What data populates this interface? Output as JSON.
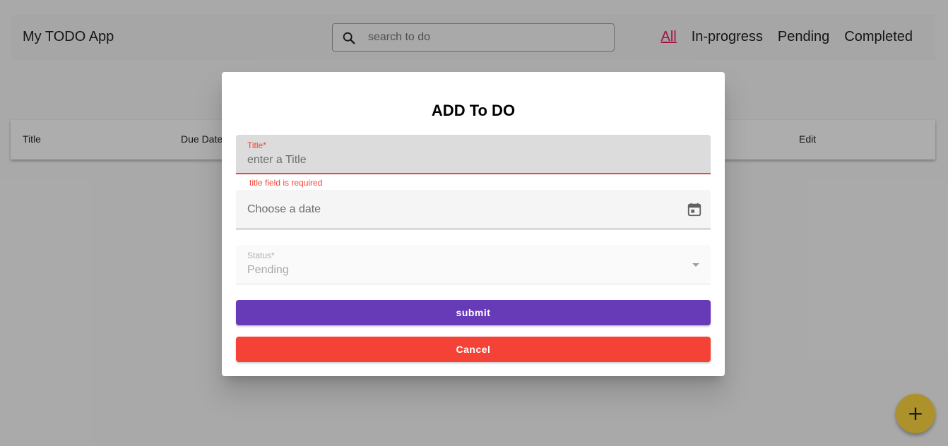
{
  "header": {
    "app_title": "My TODO App",
    "search_placeholder": "search to do",
    "nav": [
      "All",
      "In-progress",
      "Pending",
      "Completed"
    ],
    "active_nav": "All"
  },
  "table": {
    "columns": [
      "Title",
      "Due Date",
      "Edit"
    ]
  },
  "fab": {
    "label": "+"
  },
  "dialog": {
    "title": "ADD To DO",
    "title_field": {
      "label": "Title*",
      "placeholder": "enter a Title",
      "value": "",
      "error": "title field is required"
    },
    "date_field": {
      "placeholder": "Choose a date",
      "icon": "calendar-icon"
    },
    "status_field": {
      "label": "Status*",
      "value": "Pending"
    },
    "submit_label": "submit",
    "cancel_label": "Cancel"
  },
  "colors": {
    "accent_primary": "#673ab7",
    "warn": "#f44336",
    "active_link": "#e91e63",
    "fab": "#ffd740"
  }
}
